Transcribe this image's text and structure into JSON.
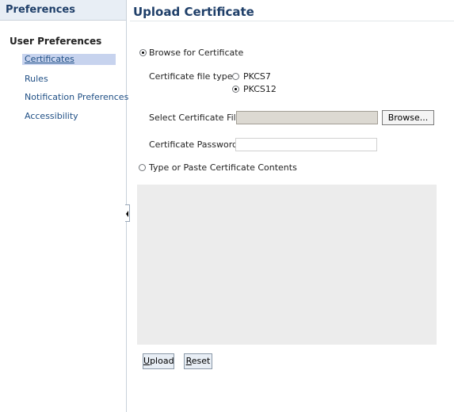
{
  "sidebar": {
    "header": "Preferences",
    "group_label": "User Preferences",
    "items": [
      {
        "label": "Certificates"
      },
      {
        "label": "Rules"
      },
      {
        "label": "Notification Preferences"
      },
      {
        "label": "Accessibility"
      }
    ]
  },
  "main": {
    "title": "Upload Certificate",
    "browse_option_label": "Browse for Certificate",
    "file_type_label": "Certificate file type",
    "file_types": [
      {
        "label": "PKCS7",
        "checked": false
      },
      {
        "label": "PKCS12",
        "checked": true
      }
    ],
    "select_file_label": "Select Certificate File",
    "file_input_value": "",
    "browse_button_label": "Browse...",
    "password_label": "Certificate Password",
    "password_value": "",
    "paste_option_label": "Type or Paste Certificate Contents",
    "paste_contents": "",
    "upload_button_first": "U",
    "upload_button_rest": "pload",
    "reset_button_first": "R",
    "reset_button_rest": "eset"
  }
}
